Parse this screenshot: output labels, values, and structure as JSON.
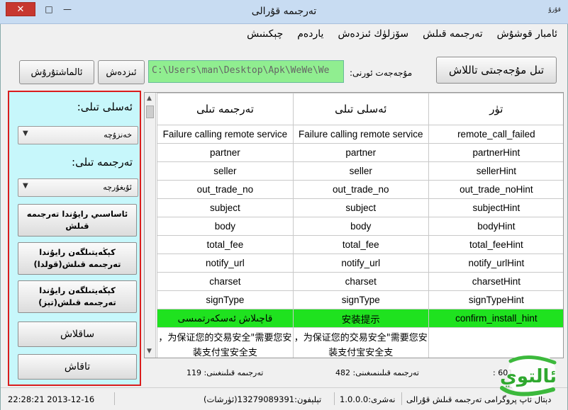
{
  "window": {
    "title": "تەرجىمە قۇرالى",
    "app_mini_label": "قۇرۇ",
    "close_symbol": "✕",
    "maximize_symbol": "□",
    "minimize_symbol": "—"
  },
  "menu": [
    "ئامبار قوشۇش",
    "تەرجىمە قىلش",
    "سۆزلۈك ئىزدەش",
    "ياردەم",
    "چېكىنىش"
  ],
  "toolbar": {
    "select_folder_label": "تىل مۇجەجىتى تاللاش",
    "path_label": "مۇجەجەت ئورنى:",
    "path_value": "C:\\Users\\man\\Desktop\\Apk\\WeWe\\We",
    "search_label": "ئىزدەش",
    "replace_label": "ئالماشتۇرۇش"
  },
  "left_panel": {
    "source_lang_label": "ئەسلى تىلى:",
    "source_lang_value": "خەنزۇچە",
    "target_lang_label": "تەرجىمە تىلى:",
    "target_lang_value": "ئۇيغۇرچە",
    "btn_auto_translate": "ئاساسىي رايۇندا تەرجىمە قىلش",
    "btn_ext_translate_1": "كېڭەيتىلگەن رايۇندا تەرجىمە قىلش(قولدا)",
    "btn_ext_translate_2": "كېڭەيتىلگەن رايۇندا تەرجىمە قىلش(تېز)",
    "btn_save": "ساقلاش",
    "btn_find": "تاقاش"
  },
  "grid": {
    "columns": [
      "تەرجىمە تىلى",
      "ئەسلى تىلى",
      "تۈر"
    ],
    "rows": [
      [
        "Failure calling remote service",
        "Failure calling remote service",
        "remote_call_failed"
      ],
      [
        "partner",
        "partner",
        "partnerHint"
      ],
      [
        "seller",
        "seller",
        "sellerHint"
      ],
      [
        "out_trade_no",
        "out_trade_no",
        "out_trade_noHint"
      ],
      [
        "subject",
        "subject",
        "subjectHint"
      ],
      [
        "body",
        "body",
        "bodyHint"
      ],
      [
        "total_fee",
        "total_fee",
        "total_feeHint"
      ],
      [
        "notify_url",
        "notify_url",
        "notify_urlHint"
      ],
      [
        "charset",
        "charset",
        "charsetHint"
      ],
      [
        "signType",
        "signType",
        "signTypeHint"
      ]
    ],
    "highlight_row": [
      "قاچىلاش ئەسكەرتمىسى",
      "安装提示",
      "confirm_install_hint"
    ],
    "partial_row": [
      "，为保证您的交易安全\"需要您安装支付宝安全支",
      "，为保证您的交易安全\"需要您安装支付宝安全支",
      ""
    ],
    "scroll_up": "▲",
    "scroll_down": "▼"
  },
  "counts": {
    "translated": "تەرجىمە قىلىنغىنى: 119",
    "untranslated": "تەرجىمە قىلىنمىغىنى: 482",
    "total": "601 :"
  },
  "statusbar": {
    "datetime": "22:28:21 2013-12-16",
    "phone": "تېلېفون:13279089391(ئۈرشات)",
    "version": "نەشرى:1.0.0.0",
    "app_name": "دېتال ئاپ پروگرامى تەرجىمە قىلش قۇرالى"
  },
  "logo": {
    "text": "ئالتوي"
  }
}
